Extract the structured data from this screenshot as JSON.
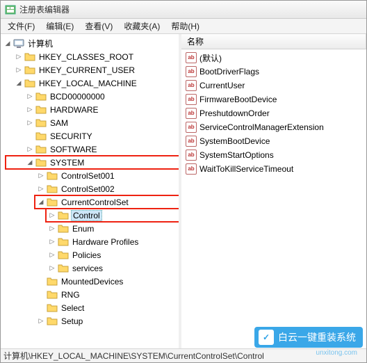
{
  "window": {
    "title": "注册表编辑器"
  },
  "menu": {
    "file": "文件(F)",
    "edit": "编辑(E)",
    "view": "查看(V)",
    "favorites": "收藏夹(A)",
    "help": "帮助(H)"
  },
  "tree": {
    "root": "计算机",
    "hkcr": "HKEY_CLASSES_ROOT",
    "hkcu": "HKEY_CURRENT_USER",
    "hklm": "HKEY_LOCAL_MACHINE",
    "hklm_children": {
      "bcd": "BCD00000000",
      "hardware": "HARDWARE",
      "sam": "SAM",
      "security": "SECURITY",
      "software": "SOFTWARE",
      "system": "SYSTEM",
      "system_children": {
        "cs001": "ControlSet001",
        "cs002": "ControlSet002",
        "ccs": "CurrentControlSet",
        "ccs_children": {
          "control": "Control",
          "enum": "Enum",
          "hwprofiles": "Hardware Profiles",
          "policies": "Policies",
          "services": "services"
        },
        "mounted": "MountedDevices",
        "rng": "RNG",
        "select": "Select",
        "setup": "Setup"
      }
    }
  },
  "list": {
    "header_name": "名称",
    "values": [
      "(默认)",
      "BootDriverFlags",
      "CurrentUser",
      "FirmwareBootDevice",
      "PreshutdownOrder",
      "ServiceControlManagerExtension",
      "SystemBootDevice",
      "SystemStartOptions",
      "WaitToKillServiceTimeout"
    ]
  },
  "statusbar": {
    "path": "计算机\\HKEY_LOCAL_MACHINE\\SYSTEM\\CurrentControlSet\\Control"
  },
  "watermark": {
    "main": "白云一键重装系统",
    "sub": "unxitong.com"
  }
}
